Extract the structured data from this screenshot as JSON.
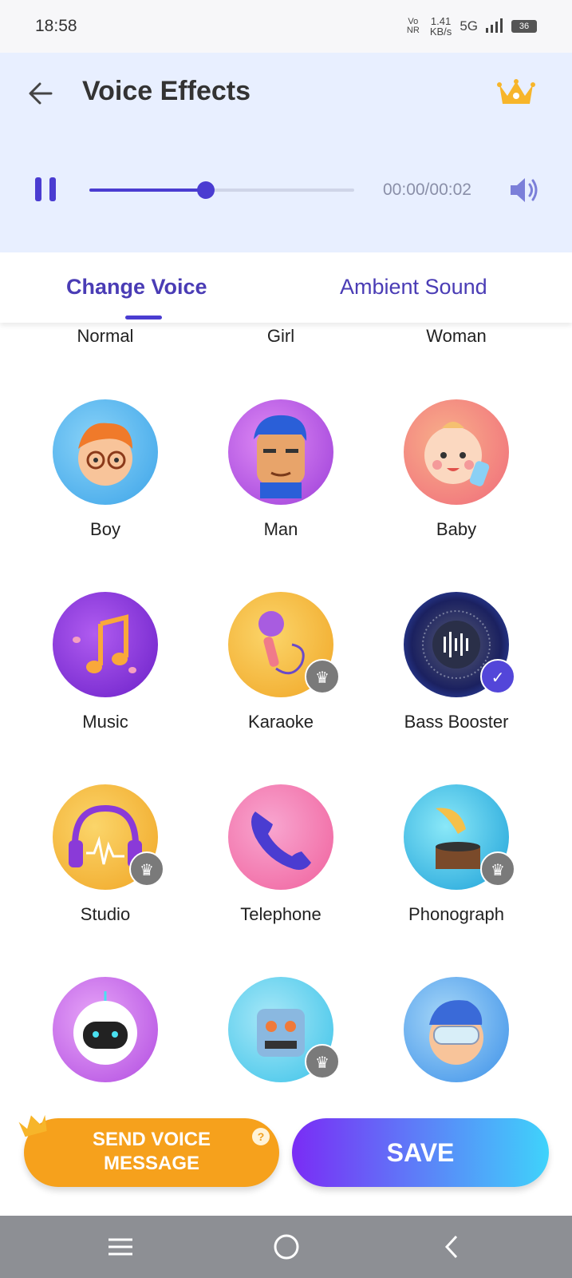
{
  "status": {
    "time": "18:58",
    "volte": "Vo NR",
    "speed_value": "1.41",
    "speed_unit": "KB/s",
    "network": "5G",
    "battery": "36"
  },
  "header": {
    "title": "Voice Effects"
  },
  "player": {
    "time": "00:00/00:02",
    "progress_fraction": 0.44
  },
  "tabs": [
    {
      "label": "Change Voice"
    },
    {
      "label": "Ambient Sound"
    }
  ],
  "effects_row0": [
    {
      "label": "Normal"
    },
    {
      "label": "Girl"
    },
    {
      "label": "Woman"
    }
  ],
  "effects": [
    {
      "label": "Boy",
      "icon": "boy-avatar-icon",
      "premium": false,
      "selected": false,
      "color": "#3ba3e8"
    },
    {
      "label": "Man",
      "icon": "man-avatar-icon",
      "premium": false,
      "selected": false,
      "color": "#b35be0"
    },
    {
      "label": "Baby",
      "icon": "baby-avatar-icon",
      "premium": false,
      "selected": false,
      "color": "#f07a6a"
    },
    {
      "label": "Music",
      "icon": "music-notes-icon",
      "premium": false,
      "selected": false,
      "color": "#8a2be2"
    },
    {
      "label": "Karaoke",
      "icon": "microphone-icon",
      "premium": true,
      "selected": false,
      "color": "#f5b52c"
    },
    {
      "label": "Bass Booster",
      "icon": "speaker-icon",
      "premium": false,
      "selected": true,
      "color": "#1b2160"
    },
    {
      "label": "Studio",
      "icon": "headphones-icon",
      "premium": true,
      "selected": false,
      "color": "#f5b52c"
    },
    {
      "label": "Telephone",
      "icon": "telephone-icon",
      "premium": false,
      "selected": false,
      "color": "#f06aa8"
    },
    {
      "label": "Phonograph",
      "icon": "phonograph-icon",
      "premium": true,
      "selected": false,
      "color": "#2bb7e0"
    },
    {
      "label": "",
      "icon": "robot-avatar-icon",
      "premium": false,
      "selected": false,
      "color": "#c96cf0"
    },
    {
      "label": "",
      "icon": "robot-box-icon",
      "premium": true,
      "selected": false,
      "color": "#3ac2e8"
    },
    {
      "label": "",
      "icon": "diver-avatar-icon",
      "premium": false,
      "selected": false,
      "color": "#3a8fe8"
    }
  ],
  "buttons": {
    "send_line1": "SEND VOICE",
    "send_line2": "MESSAGE",
    "save": "SAVE",
    "help": "?"
  },
  "colors": {
    "accent": "#4a3cd1",
    "header_bg": "#e8efff",
    "send": "#f6a11c"
  }
}
